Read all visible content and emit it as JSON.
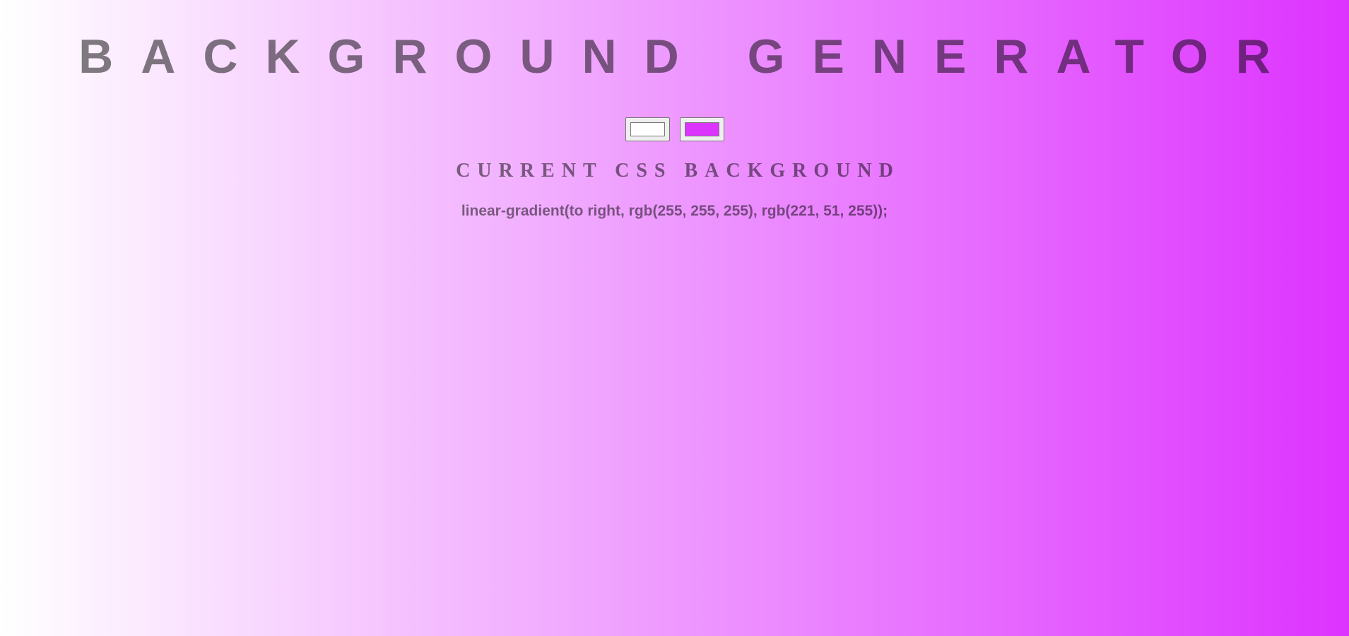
{
  "header": {
    "title": "BACKGROUND GENERATOR"
  },
  "pickers": {
    "color1": {
      "value": "#ffffff"
    },
    "color2": {
      "value": "#dd33ff"
    }
  },
  "output": {
    "heading": "CURRENT CSS BACKGROUND",
    "css_text": "linear-gradient(to right, rgb(255, 255, 255), rgb(221, 51, 255));"
  },
  "colors": {
    "gradient_start": "#ffffff",
    "gradient_end": "#dd33ff"
  }
}
